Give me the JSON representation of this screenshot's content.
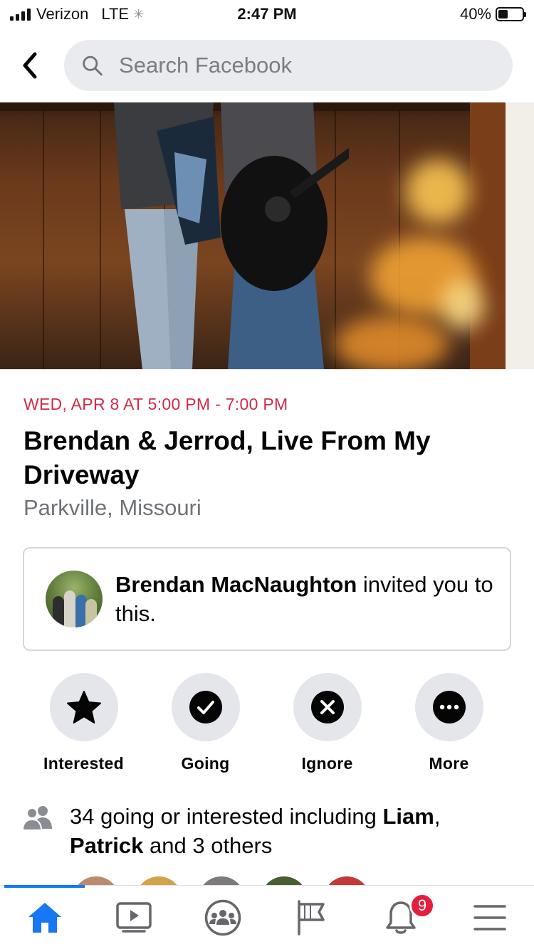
{
  "status_bar": {
    "carrier": "Verizon",
    "network": "LTE",
    "time": "2:47 PM",
    "battery_percent": "40%",
    "battery_level": 0.4
  },
  "search": {
    "placeholder": "Search Facebook"
  },
  "event": {
    "date": "WED, APR 8 AT 5:00 PM - 7:00 PM",
    "title": "Brendan & Jerrod, Live From My Driveway",
    "location": "Parkville, Missouri"
  },
  "invite": {
    "inviter": "Brendan MacNaughton",
    "message": " invited you to this."
  },
  "actions": [
    {
      "label": "Interested",
      "icon": "star-icon"
    },
    {
      "label": "Going",
      "icon": "check-circle-icon"
    },
    {
      "label": "Ignore",
      "icon": "x-circle-icon"
    },
    {
      "label": "More",
      "icon": "more-dots-icon"
    }
  ],
  "attendees": {
    "prefix": "34 going or interested including ",
    "name1": "Liam",
    "separator": ", ",
    "name2": "Patrick",
    "suffix": " and 3 others"
  },
  "tab_bar": {
    "tabs": [
      "home-icon",
      "watch-icon",
      "groups-icon",
      "pages-flag-icon",
      "notifications-bell-icon",
      "menu-icon"
    ],
    "active": "home-icon",
    "notification_count": "9",
    "accent": "#1877f2"
  },
  "colors": {
    "date_red": "#d12b49",
    "badge_red": "#e41e3f",
    "circle_gray": "#e4e6eb"
  }
}
